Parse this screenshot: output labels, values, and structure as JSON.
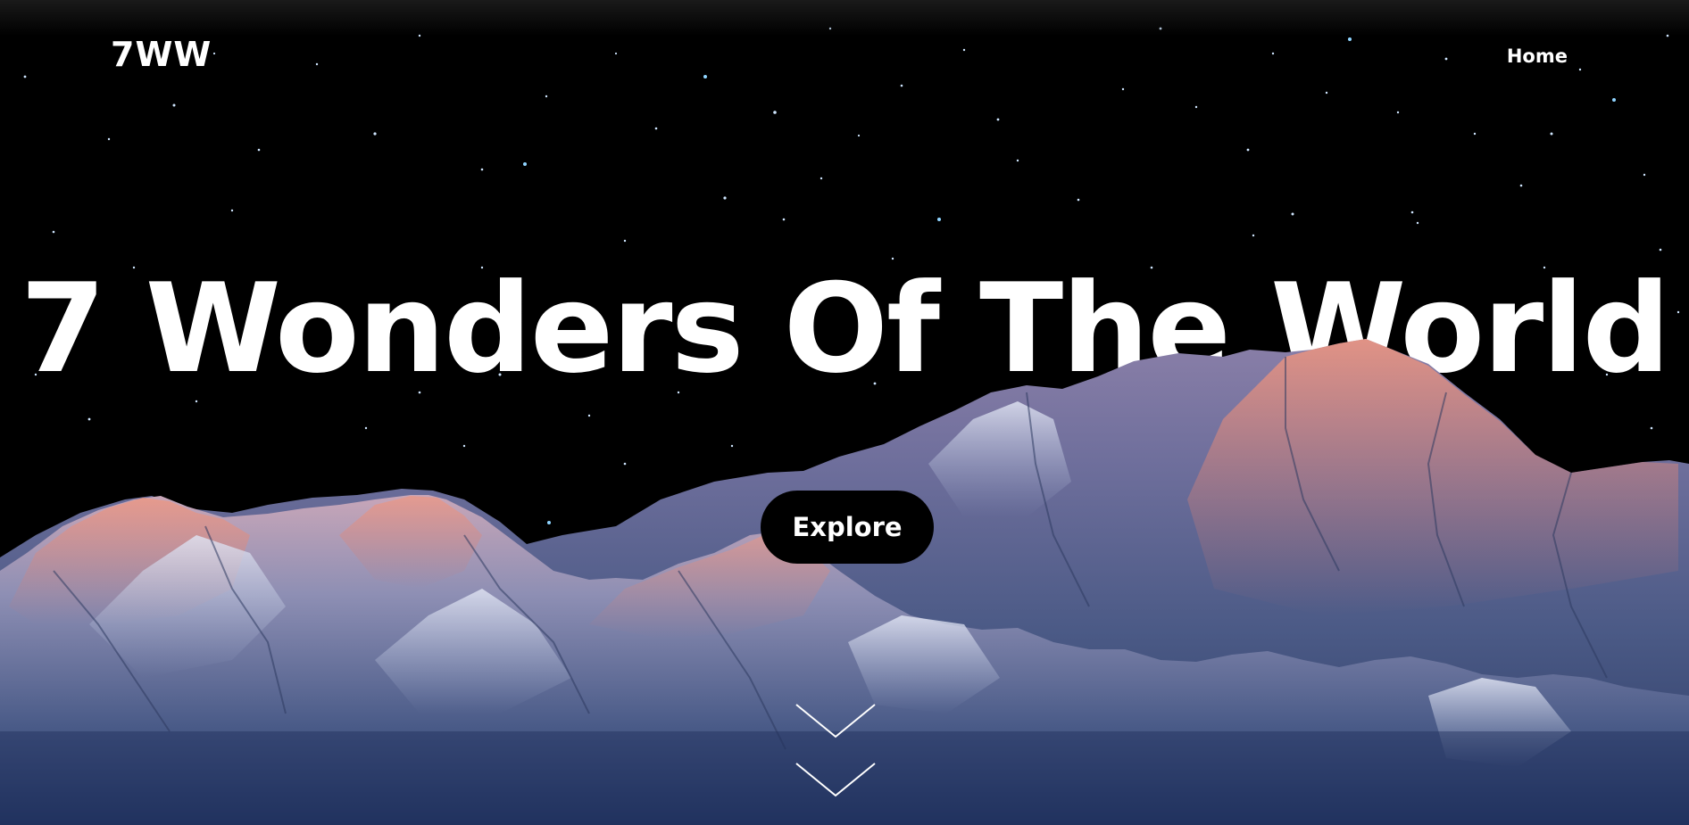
{
  "nav": {
    "logo": "7WW",
    "home_label": "Home"
  },
  "hero": {
    "title": "7 Wonders Of The World",
    "cta_label": "Explore",
    "scroll_icon": "double-chevron-down-icon",
    "background": "starry-sky-mountain-range"
  },
  "colors": {
    "sky": "#000000",
    "text": "#ffffff",
    "button_bg": "#000000",
    "peak_glow": "#e08a7c",
    "mountain_shadow": "#3f4f7a",
    "mountain_base": "#2c3c66"
  }
}
